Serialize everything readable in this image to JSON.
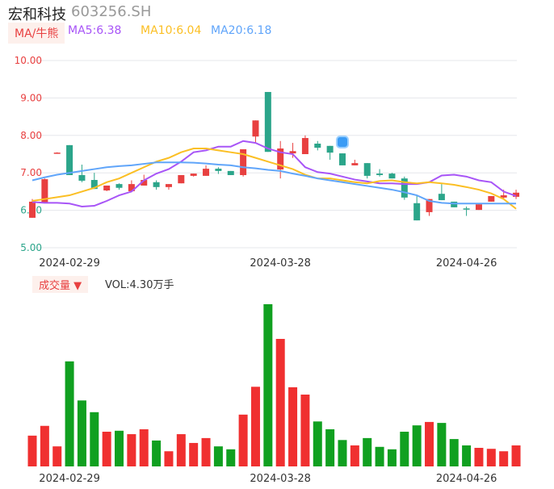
{
  "header": {
    "name": "宏和科技",
    "code": "603256.SH"
  },
  "legend": {
    "ma_badge": "MA/牛熊",
    "ma5": "MA5:6.38",
    "ma10": "MA10:6.04",
    "ma20": "MA20:6.18"
  },
  "volume_legend": {
    "badge": "成交量 ▼",
    "vol": "VOL:4.30万手"
  },
  "colors": {
    "up": "#e84040",
    "down": "#2ba58a",
    "ma5": "#a855f7",
    "ma10": "#fbbf24",
    "ma20": "#60a5fa",
    "grid": "#e5e7eb"
  },
  "chart_data": [
    {
      "type": "candlestick",
      "title": "宏和科技 603256.SH",
      "ylim": [
        5,
        10
      ],
      "yticks": [
        "10.00",
        "9.00",
        "8.00",
        "7.00",
        "6.00",
        "5.00"
      ],
      "xticks": [
        {
          "index": 3,
          "label": "2024-02-29"
        },
        {
          "index": 20,
          "label": "2024-03-28"
        },
        {
          "index": 35,
          "label": "2024-04-26"
        }
      ],
      "ohlc": [
        [
          5.8,
          6.3,
          5.8,
          6.23
        ],
        [
          6.19,
          6.85,
          6.19,
          6.83
        ],
        [
          7.54,
          7.55,
          7.53,
          7.54
        ],
        [
          7.74,
          7.74,
          6.94,
          6.94
        ],
        [
          6.94,
          7.22,
          6.75,
          6.79
        ],
        [
          6.81,
          7.0,
          6.57,
          6.57
        ],
        [
          6.53,
          6.66,
          6.51,
          6.66
        ],
        [
          6.7,
          6.72,
          6.55,
          6.6
        ],
        [
          6.51,
          6.8,
          6.51,
          6.7
        ],
        [
          6.66,
          6.95,
          6.66,
          6.81
        ],
        [
          6.75,
          6.8,
          6.55,
          6.62
        ],
        [
          6.62,
          6.7,
          6.55,
          6.7
        ],
        [
          6.72,
          6.94,
          6.72,
          6.94
        ],
        [
          6.92,
          6.98,
          6.9,
          6.98
        ],
        [
          6.92,
          7.2,
          6.92,
          7.11
        ],
        [
          7.11,
          7.15,
          6.97,
          7.05
        ],
        [
          7.05,
          7.05,
          6.94,
          6.94
        ],
        [
          6.94,
          7.63,
          6.9,
          7.63
        ],
        [
          7.97,
          8.4,
          7.8,
          8.4
        ],
        [
          9.16,
          9.16,
          7.56,
          7.56
        ],
        [
          7.09,
          7.85,
          6.85,
          7.65
        ],
        [
          7.52,
          7.8,
          7.4,
          7.58
        ],
        [
          7.5,
          8.0,
          7.5,
          7.93
        ],
        [
          7.78,
          7.85,
          7.6,
          7.67
        ],
        [
          7.72,
          7.72,
          7.35,
          7.54
        ],
        [
          7.52,
          7.52,
          7.2,
          7.2
        ],
        [
          7.2,
          7.35,
          7.2,
          7.26
        ],
        [
          7.26,
          7.26,
          6.85,
          6.92
        ],
        [
          6.98,
          7.1,
          6.9,
          6.94
        ],
        [
          6.98,
          7.0,
          6.85,
          6.85
        ],
        [
          6.85,
          6.9,
          6.28,
          6.34
        ],
        [
          6.19,
          6.4,
          5.73,
          5.73
        ],
        [
          5.95,
          6.3,
          5.85,
          6.3
        ],
        [
          6.44,
          6.7,
          6.27,
          6.27
        ],
        [
          6.23,
          6.23,
          6.08,
          6.08
        ],
        [
          6.05,
          6.1,
          5.85,
          6.03
        ],
        [
          6.01,
          6.16,
          6.01,
          6.16
        ],
        [
          6.23,
          6.38,
          6.23,
          6.38
        ],
        [
          6.34,
          6.55,
          6.3,
          6.4
        ],
        [
          6.36,
          6.55,
          6.3,
          6.47
        ]
      ],
      "series": [
        {
          "name": "MA5",
          "values": [
            6.22,
            6.2,
            6.2,
            6.18,
            6.1,
            6.12,
            6.25,
            6.4,
            6.5,
            6.8,
            6.98,
            7.1,
            7.3,
            7.55,
            7.6,
            7.7,
            7.7,
            7.85,
            7.8,
            7.65,
            7.55,
            7.5,
            7.15,
            7.02,
            6.98,
            6.9,
            6.82,
            6.77,
            6.72,
            6.72,
            6.7,
            6.7,
            6.75,
            6.93,
            6.95,
            6.9,
            6.8,
            6.75,
            6.5,
            6.38
          ]
        },
        {
          "name": "MA10",
          "values": [
            6.25,
            6.3,
            6.35,
            6.4,
            6.5,
            6.6,
            6.75,
            6.85,
            7.0,
            7.15,
            7.3,
            7.4,
            7.55,
            7.65,
            7.65,
            7.6,
            7.55,
            7.5,
            7.4,
            7.3,
            7.2,
            7.1,
            6.95,
            6.85,
            6.85,
            6.8,
            6.75,
            6.72,
            6.78,
            6.8,
            6.75,
            6.72,
            6.75,
            6.72,
            6.68,
            6.62,
            6.55,
            6.45,
            6.3,
            6.04
          ]
        },
        {
          "name": "MA20",
          "values": [
            6.8,
            6.88,
            6.95,
            7.0,
            7.05,
            7.1,
            7.15,
            7.18,
            7.2,
            7.24,
            7.28,
            7.28,
            7.28,
            7.27,
            7.25,
            7.22,
            7.2,
            7.15,
            7.12,
            7.08,
            7.05,
            6.98,
            6.92,
            6.85,
            6.8,
            6.75,
            6.7,
            6.65,
            6.6,
            6.55,
            6.48,
            6.4,
            6.25,
            6.2,
            6.18,
            6.18,
            6.18,
            6.18,
            6.18,
            6.18
          ]
        }
      ]
    },
    {
      "type": "bar",
      "title": "成交量",
      "unit": "万手",
      "values": [
        6.3,
        8.3,
        4.1,
        21.5,
        13.5,
        11.1,
        7.1,
        7.3,
        6.6,
        7.6,
        5.3,
        3.1,
        6.6,
        4.8,
        5.8,
        4.1,
        3.5,
        10.6,
        16.3,
        33.2,
        26.1,
        16.2,
        14.7,
        9.2,
        7.6,
        5.4,
        4.3,
        5.8,
        4.0,
        3.5,
        7.1,
        8.4,
        9.1,
        8.9,
        5.6,
        4.3,
        3.8,
        3.6,
        3.1,
        4.3
      ]
    }
  ]
}
